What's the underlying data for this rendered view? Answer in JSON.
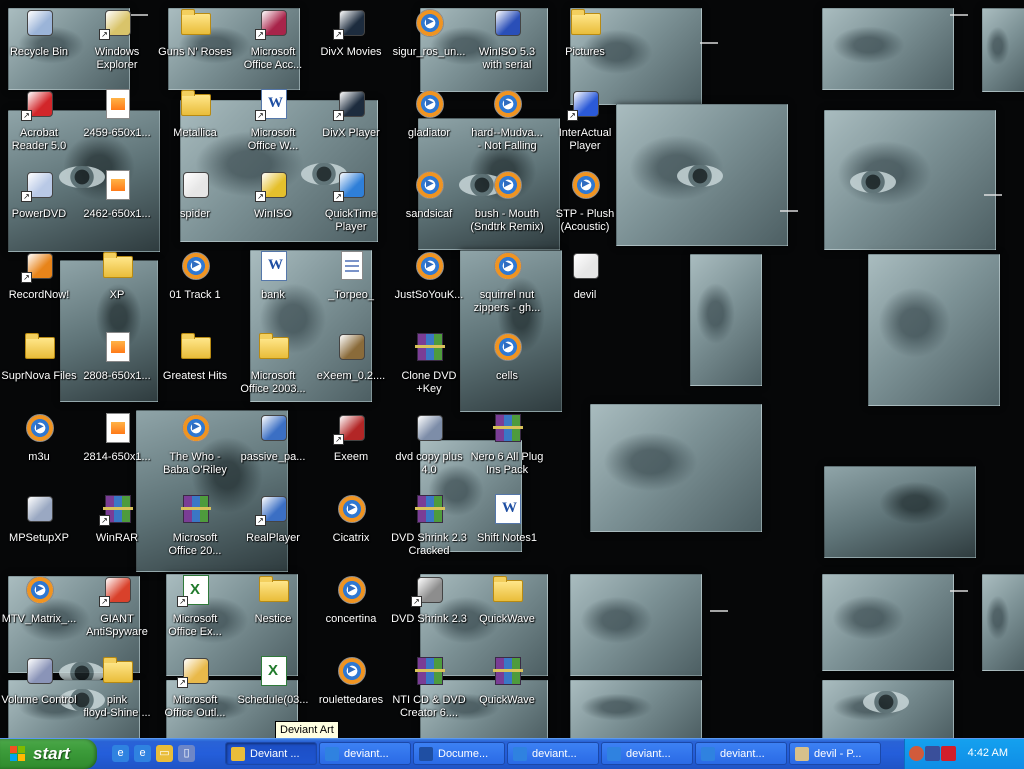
{
  "desktop": {
    "icons": [
      {
        "label": "Recycle Bin",
        "icon": "recycle-bin-icon",
        "type": "generic",
        "color": "#9bb4d8",
        "shortcut": false
      },
      {
        "label": "Windows\nExplorer",
        "icon": "explorer-icon",
        "type": "generic",
        "color": "#d9c46a",
        "shortcut": true
      },
      {
        "label": "Guns N' Roses",
        "icon": "folder-icon",
        "type": "folder",
        "shortcut": false
      },
      {
        "label": "Microsoft\nOffice Acc...",
        "icon": "access-icon",
        "type": "generic",
        "color": "#a8244a",
        "shortcut": true
      },
      {
        "label": "DivX Movies",
        "icon": "divx-icon",
        "type": "generic",
        "color": "#1d2c3e",
        "shortcut": true
      },
      {
        "label": "sigur_ros_un...",
        "icon": "media-file-icon",
        "type": "media",
        "shortcut": false
      },
      {
        "label": "WinISO 5.3\nwith serial",
        "icon": "winiso-archive-icon",
        "type": "generic",
        "color": "#2a4fb8",
        "shortcut": false
      },
      {
        "label": "Pictures",
        "icon": "folder-icon",
        "type": "folder",
        "shortcut": false
      },
      {
        "label": "Acrobat\nReader 5.0",
        "icon": "acrobat-icon",
        "type": "generic",
        "color": "#d2262a",
        "shortcut": true
      },
      {
        "label": "2459-650x1...",
        "icon": "image-file-icon",
        "type": "img",
        "shortcut": false
      },
      {
        "label": "Metallica",
        "icon": "folder-icon",
        "type": "folder",
        "shortcut": false
      },
      {
        "label": "Microsoft\nOffice W...",
        "icon": "word-icon",
        "type": "word",
        "shortcut": true
      },
      {
        "label": "DivX Player",
        "icon": "divx-icon",
        "type": "generic",
        "color": "#1d2c3e",
        "shortcut": true
      },
      {
        "label": "gladiator",
        "icon": "media-file-icon",
        "type": "media",
        "shortcut": false
      },
      {
        "label": "hard--Mudva...\n- Not Falling",
        "icon": "media-file-icon",
        "type": "media",
        "shortcut": false
      },
      {
        "label": "InterActual\nPlayer",
        "icon": "interactual-icon",
        "type": "generic",
        "color": "#2b5ad8",
        "shortcut": true
      },
      {
        "label": "PowerDVD",
        "icon": "powerdvd-icon",
        "type": "generic",
        "color": "#b9c9e6",
        "shortcut": true
      },
      {
        "label": "2462-650x1...",
        "icon": "image-file-icon",
        "type": "img",
        "shortcut": false
      },
      {
        "label": "spider",
        "icon": "paint-file-icon",
        "type": "generic",
        "color": "#e6e6e6",
        "shortcut": false
      },
      {
        "label": "WinISO",
        "icon": "winiso-icon",
        "type": "generic",
        "color": "#e5c02c",
        "shortcut": true
      },
      {
        "label": "QuickTime\nPlayer",
        "icon": "quicktime-icon",
        "type": "generic",
        "color": "#2f7fd8",
        "shortcut": true
      },
      {
        "label": "sandsicaf",
        "icon": "media-file-icon",
        "type": "media",
        "shortcut": false
      },
      {
        "label": "bush - Mouth\n(Sndtrk Remix)",
        "icon": "media-file-icon",
        "type": "media",
        "shortcut": false
      },
      {
        "label": "STP - Plush\n(Acoustic)",
        "icon": "media-file-icon",
        "type": "media",
        "shortcut": false
      },
      {
        "label": "RecordNow!",
        "icon": "recordnow-icon",
        "type": "generic",
        "color": "#e8841a",
        "shortcut": true
      },
      {
        "label": "XP",
        "icon": "folder-icon",
        "type": "folder",
        "shortcut": false
      },
      {
        "label": "01 Track 1",
        "icon": "media-file-icon",
        "type": "media",
        "shortcut": false
      },
      {
        "label": "bank",
        "icon": "word-doc-icon",
        "type": "word",
        "shortcut": false
      },
      {
        "label": "_Torpeo_",
        "icon": "document-icon",
        "type": "doc",
        "shortcut": false
      },
      {
        "label": "JustSoYouK...",
        "icon": "media-file-icon",
        "type": "media",
        "shortcut": false
      },
      {
        "label": "squirrel nut\nzippers - gh...",
        "icon": "media-file-icon",
        "type": "media",
        "shortcut": false
      },
      {
        "label": "devil",
        "icon": "paint-file-icon",
        "type": "generic",
        "color": "#e6e6e6",
        "shortcut": false
      },
      {
        "label": "SuprNova Files",
        "icon": "folder-icon",
        "type": "folder",
        "shortcut": false
      },
      {
        "label": "2808-650x1...",
        "icon": "image-file-icon",
        "type": "img",
        "shortcut": false
      },
      {
        "label": "Greatest Hits",
        "icon": "folder-icon",
        "type": "folder",
        "shortcut": false
      },
      {
        "label": "Microsoft\nOffice 2003...",
        "icon": "folder-icon",
        "type": "folder",
        "shortcut": false
      },
      {
        "label": "eXeem_0.2....",
        "icon": "exeem-installer-icon",
        "type": "generic",
        "color": "#8a6b3a",
        "shortcut": false
      },
      {
        "label": "Clone DVD\n+Key",
        "icon": "winrar-archive-icon",
        "type": "winrar",
        "shortcut": false
      },
      {
        "label": "cells",
        "icon": "media-file-icon",
        "type": "media",
        "shortcut": false
      },
      {
        "label": "",
        "icon": "",
        "type": "none",
        "shortcut": false
      },
      {
        "label": "m3u",
        "icon": "media-file-icon",
        "type": "media",
        "shortcut": false
      },
      {
        "label": "2814-650x1...",
        "icon": "image-file-icon",
        "type": "img",
        "shortcut": false
      },
      {
        "label": "The Who -\nBaba O'Riley",
        "icon": "media-file-icon",
        "type": "media",
        "shortcut": false
      },
      {
        "label": "passive_pa...",
        "icon": "realplayer-file-icon",
        "type": "generic",
        "color": "#3b6fc4",
        "shortcut": false
      },
      {
        "label": "Exeem",
        "icon": "exeem-icon",
        "type": "generic",
        "color": "#b32626",
        "shortcut": true
      },
      {
        "label": "dvd copy plus\n4.0",
        "icon": "installer-icon",
        "type": "generic",
        "color": "#7d8da8",
        "shortcut": false
      },
      {
        "label": "Nero 6 All Plug\nIns Pack",
        "icon": "winrar-archive-icon",
        "type": "winrar",
        "shortcut": false
      },
      {
        "label": "",
        "icon": "",
        "type": "none",
        "shortcut": false
      },
      {
        "label": "MPSetupXP",
        "icon": "setup-icon",
        "type": "generic",
        "color": "#9aa8c2",
        "shortcut": false
      },
      {
        "label": "WinRAR",
        "icon": "winrar-icon",
        "type": "winrar",
        "shortcut": true
      },
      {
        "label": "Microsoft\nOffice 20...",
        "icon": "winrar-archive-icon",
        "type": "winrar",
        "shortcut": false
      },
      {
        "label": "RealPlayer",
        "icon": "realplayer-icon",
        "type": "generic",
        "color": "#3b6fc4",
        "shortcut": true
      },
      {
        "label": "Cicatrix",
        "icon": "media-file-icon",
        "type": "media",
        "shortcut": false
      },
      {
        "label": "DVD Shrink 2.3\nCracked",
        "icon": "winrar-archive-icon",
        "type": "winrar",
        "shortcut": false
      },
      {
        "label": "Shift Notes1",
        "icon": "word-doc-icon",
        "type": "word",
        "shortcut": false
      },
      {
        "label": "",
        "icon": "",
        "type": "none",
        "shortcut": false
      },
      {
        "label": "MTV_Matrix_...",
        "icon": "media-file-icon",
        "type": "media",
        "shortcut": false
      },
      {
        "label": "GIANT\nAntiSpyware",
        "icon": "antispyware-icon",
        "type": "generic",
        "color": "#d9412b",
        "shortcut": true
      },
      {
        "label": "Microsoft\nOffice Ex...",
        "icon": "excel-icon",
        "type": "excel",
        "shortcut": true
      },
      {
        "label": "Nestice",
        "icon": "folder-icon",
        "type": "folder",
        "shortcut": false
      },
      {
        "label": "concertina",
        "icon": "media-file-icon",
        "type": "media",
        "shortcut": false
      },
      {
        "label": "DVD Shrink 2.3",
        "icon": "dvd-shrink-icon",
        "type": "generic",
        "color": "#8d8d8d",
        "shortcut": true
      },
      {
        "label": "QuickWave",
        "icon": "folder-icon",
        "type": "folder",
        "shortcut": false
      },
      {
        "label": "",
        "icon": "",
        "type": "none",
        "shortcut": false
      },
      {
        "label": "Volume Control",
        "icon": "volume-control-icon",
        "type": "generic",
        "color": "#8a94b8",
        "shortcut": false
      },
      {
        "label": "pink\nfloyd-Shine ...",
        "icon": "folder-icon",
        "type": "folder",
        "shortcut": false
      },
      {
        "label": "Microsoft\nOffice Outl...",
        "icon": "outlook-icon",
        "type": "generic",
        "color": "#e9b94a",
        "shortcut": true
      },
      {
        "label": "Schedule(03...",
        "icon": "excel-doc-icon",
        "type": "excel",
        "shortcut": false
      },
      {
        "label": "roulettedares",
        "icon": "media-file-icon",
        "type": "media",
        "shortcut": false
      },
      {
        "label": "NTI CD & DVD\nCreator 6....",
        "icon": "winrar-archive-icon",
        "type": "winrar",
        "shortcut": false
      },
      {
        "label": "QuickWave",
        "icon": "winrar-archive-icon",
        "type": "winrar",
        "shortcut": false
      },
      {
        "label": "",
        "icon": "",
        "type": "none",
        "shortcut": false
      }
    ]
  },
  "tooltip": "Deviant Art",
  "taskbar": {
    "start_label": "start",
    "quicklaunch": [
      {
        "icon": "ie-icon",
        "color": "#2f82e0",
        "glyph": "e"
      },
      {
        "icon": "ie-icon",
        "color": "#2f82e0",
        "glyph": "e"
      },
      {
        "icon": "folder-icon",
        "color": "#e9bd3a",
        "glyph": "▭"
      },
      {
        "icon": "window-icon",
        "color": "#6d86c7",
        "glyph": "▯"
      }
    ],
    "tasks": [
      {
        "label": "Deviant ...",
        "icon": "folder-icon",
        "color": "#e9bd3a",
        "active": true
      },
      {
        "label": "deviant...",
        "icon": "ie-icon",
        "color": "#2f82e0",
        "active": false
      },
      {
        "label": "Docume...",
        "icon": "word-icon",
        "color": "#1f4fa3",
        "active": false
      },
      {
        "label": "deviant...",
        "icon": "ie-icon",
        "color": "#2f82e0",
        "active": false
      },
      {
        "label": "deviant...",
        "icon": "ie-icon",
        "color": "#2f82e0",
        "active": false
      },
      {
        "label": "deviant...",
        "icon": "ie-icon",
        "color": "#2f82e0",
        "active": false
      },
      {
        "label": "devil - P...",
        "icon": "paint-icon",
        "color": "#d7c08b",
        "active": false
      }
    ],
    "tray": {
      "time": "4:42 AM",
      "icons": [
        {
          "icon": "chevron-left-icon",
          "color": "#d15b3b"
        },
        {
          "icon": "network-icon",
          "color": "#3a4f9a"
        },
        {
          "icon": "kaspersky-icon",
          "color": "#d11f2a"
        }
      ]
    }
  }
}
